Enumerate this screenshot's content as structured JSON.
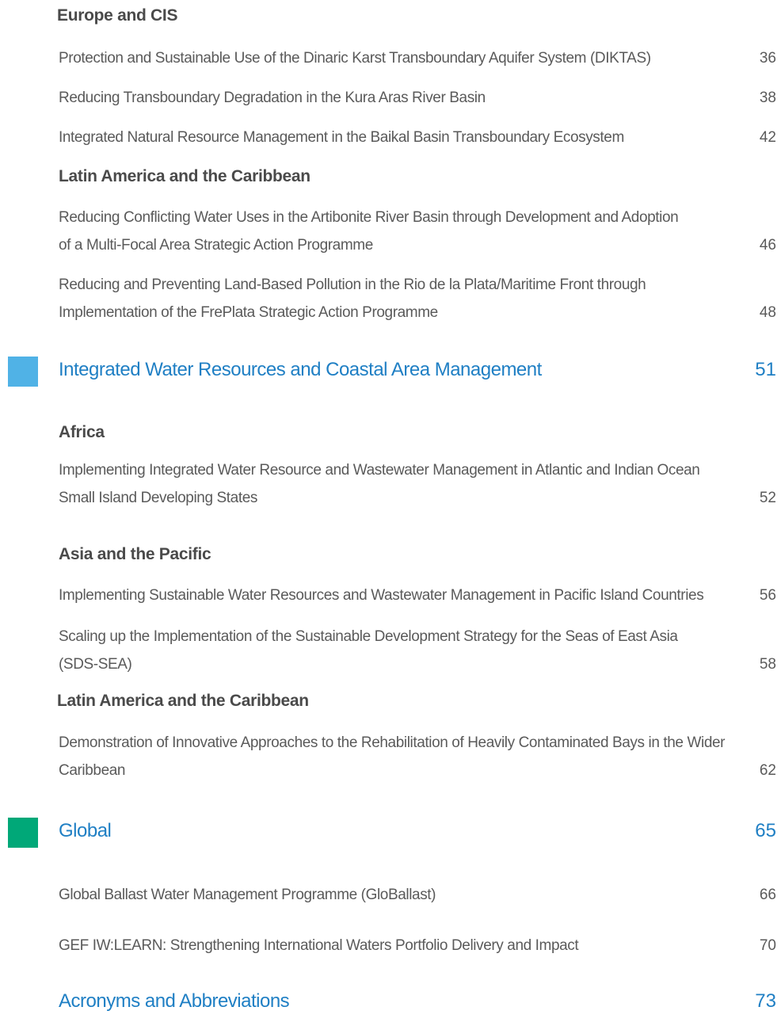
{
  "colors": {
    "section_blue_square": "#50b2e6",
    "section_green_square": "#00a878",
    "section_title": "#1f7fc4",
    "body_text": "#5a5a5a",
    "heading_text": "#4a4a4a"
  },
  "europe_cis": {
    "heading": "Europe and CIS",
    "items": [
      {
        "line1": "Protection and Sustainable Use of the Dinaric Karst Transboundary Aquifer System (DIKTAS)",
        "page": "36"
      },
      {
        "line1": "Reducing Transboundary Degradation in the Kura Aras River Basin",
        "page": "38"
      },
      {
        "line1": "Integrated Natural Resource Management in the Baikal Basin Transboundary Ecosystem",
        "page": "42"
      }
    ]
  },
  "lac1": {
    "heading": "Latin America and the Caribbean",
    "items": [
      {
        "line1": "Reducing Conflicting Water Uses in the Artibonite River Basin through Development and Adoption",
        "line2": "of a Multi-Focal Area Strategic Action Programme",
        "page": "46"
      },
      {
        "line1": "Reducing and Preventing Land-Based Pollution in the Rio de la Plata/Maritime Front through",
        "line2": "Implementation of the FrePlata Strategic Action Programme",
        "page": "48"
      }
    ]
  },
  "iwrm_section": {
    "title": "Integrated Water Resources and Coastal Area Management",
    "page": "51"
  },
  "africa": {
    "heading": "Africa",
    "items": [
      {
        "line1": "Implementing Integrated Water Resource and Wastewater Management in Atlantic and Indian Ocean",
        "line2": "Small Island Developing States",
        "page": "52"
      }
    ]
  },
  "asia_pacific": {
    "heading": "Asia and the Pacific",
    "items": [
      {
        "line1": "Implementing Sustainable Water Resources and Wastewater Management in Pacific Island Countries",
        "page": "56"
      },
      {
        "line1": "Scaling up the Implementation of the Sustainable Development Strategy for the Seas of East Asia",
        "line2": "(SDS-SEA)",
        "page": "58"
      }
    ]
  },
  "lac2": {
    "heading": "Latin America and the Caribbean",
    "items": [
      {
        "line1": "Demonstration of Innovative Approaches to the Rehabilitation of Heavily Contaminated Bays in the Wider",
        "line2": "Caribbean",
        "page": "62"
      }
    ]
  },
  "global_section": {
    "title": "Global",
    "page": "65",
    "items": [
      {
        "line1": "Global Ballast Water Management  Programme (GloBallast)",
        "page": "66"
      },
      {
        "line1": "GEF IW:LEARN: Strengthening International Waters Portfolio Delivery and Impact",
        "page": "70"
      }
    ]
  },
  "acronyms_section": {
    "title": "Acronyms and Abbreviations",
    "page": "73"
  }
}
